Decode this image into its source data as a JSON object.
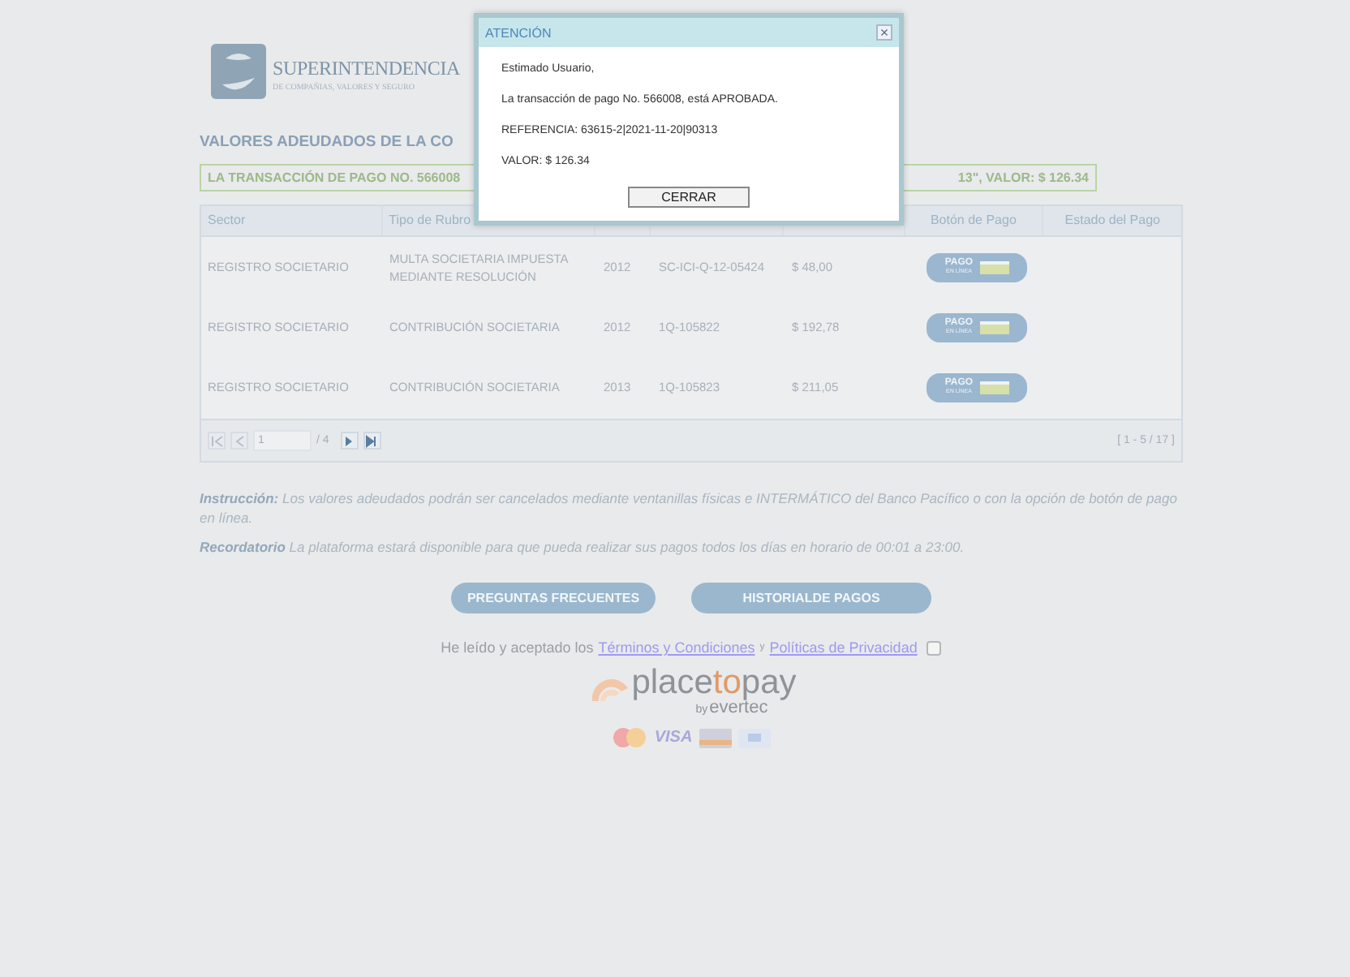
{
  "header": {
    "logo_title": "SUPERINTENDENCIA",
    "logo_subtitle": "DE COMPAÑIAS, VALORES Y SEGURO"
  },
  "heading": "VALORES ADEUDADOS DE LA CO",
  "banner": {
    "left": "LA TRANSACCIÓN DE PAGO NO. 566008",
    "right": "13\", VALOR: $ 126.34"
  },
  "table": {
    "columns": [
      {
        "label": "Sector",
        "kind": "text"
      },
      {
        "label": "Tipo de Rubro",
        "kind": "text"
      },
      {
        "kind": "hidden"
      },
      {
        "kind": "hidden"
      },
      {
        "kind": "hidden"
      },
      {
        "label": "Botón de Pago",
        "kind": "text"
      },
      {
        "label": "Estado del Pago",
        "kind": "text"
      }
    ],
    "rows": [
      {
        "sector": "REGISTRO SOCIETARIO",
        "tipo": "MULTA SOCIETARIA IMPUESTA MEDIANTE RESOLUCIÓN",
        "year": "2012",
        "code": "SC-ICI-Q-12-05424",
        "amount": "$ 48,00",
        "pay_top": "PAGO",
        "pay_bottom": "EN LÍNEA"
      },
      {
        "sector": "REGISTRO SOCIETARIO",
        "tipo": "CONTRIBUCIÓN SOCIETARIA",
        "year": "2012",
        "code": "1Q-105822",
        "amount": "$ 192,78",
        "pay_top": "PAGO",
        "pay_bottom": "EN LÍNEA"
      },
      {
        "sector": "REGISTRO SOCIETARIO",
        "tipo": "CONTRIBUCIÓN SOCIETARIA",
        "year": "2013",
        "code": "1Q-105823",
        "amount": "$ 211,05",
        "pay_top": "PAGO",
        "pay_bottom": "EN LÍNEA"
      }
    ],
    "pager": {
      "page": "1",
      "of": "/ 4",
      "range": "[ 1 - 5 / 17 ]"
    }
  },
  "instruction": {
    "label": "Instrucción:",
    "text": "Los valores adeudados podrán ser cancelados mediante ventanillas físicas e INTERMÁTICO del Banco Pacífico o con la opción de botón de pago en línea."
  },
  "reminder": {
    "label": "Recordatorio",
    "text": "La plataforma estará disponible para que pueda realizar sus pagos todos los días en horario de 00:01 a 23:00."
  },
  "buttons": [
    "PREGUNTAS FRECUENTES",
    "HISTORIALDE PAGOS"
  ],
  "terms": {
    "before": "He leído y aceptado los",
    "link1": "Términos y Condiciones",
    "joiner": "y",
    "link2": "Políticas de Privacidad",
    "checked": false
  },
  "brand": {
    "part1": "place",
    "part2": "to",
    "part3": "pay",
    "by": "by",
    "maker": "evertec",
    "card": "VISA"
  },
  "modal": {
    "title": "ATENCIÓN",
    "close": "×",
    "lines": [
      "Estimado Usuario,",
      "La transacción de pago No. 566008, está APROBADA.",
      "REFERENCIA: 63615-2|2021-11-20|90313",
      "VALOR: $ 126.34"
    ],
    "button": "CERRAR"
  }
}
